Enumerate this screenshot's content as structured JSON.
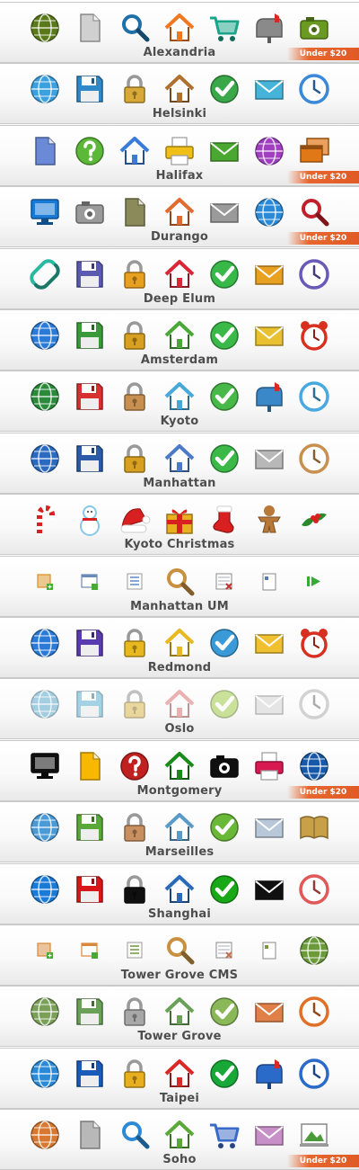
{
  "badge_text": "Under $20",
  "icon_sets": [
    {
      "name": "Alexandria",
      "badge": true,
      "style": "green-flat",
      "icons": [
        "globe-icon",
        "document-icon",
        "search-icon",
        "home-icon",
        "shopping-cart-icon",
        "mailbox-icon",
        "camera-icon"
      ],
      "colors": [
        "#5a7a1a",
        "#d0d0d0",
        "#1f6fa8",
        "#f07820",
        "#1aa58a",
        "#8a8a8a",
        "#6a9a22"
      ]
    },
    {
      "name": "Helsinki",
      "badge": false,
      "style": "outlined-blue",
      "icons": [
        "globe-icon",
        "floppy-disk-icon",
        "lock-icon",
        "home-icon",
        "checkmark-icon",
        "mail-icon",
        "clock-icon"
      ],
      "colors": [
        "#3aa0e0",
        "#2f88c8",
        "#d8a838",
        "#b07030",
        "#3aa848",
        "#45b4d8",
        "#3a88d8"
      ]
    },
    {
      "name": "Halifax",
      "badge": true,
      "style": "glossy",
      "icons": [
        "document-icon",
        "help-icon",
        "home-icon",
        "printer-icon",
        "mail-icon",
        "globe-icon",
        "windows-icon"
      ],
      "colors": [
        "#6a8ad8",
        "#5cb838",
        "#3a7ad8",
        "#f0c018",
        "#4aa830",
        "#a040c0",
        "#e07818"
      ]
    },
    {
      "name": "Durango",
      "badge": true,
      "style": "round",
      "icons": [
        "monitor-icon",
        "camera-icon",
        "document-icon",
        "home-icon",
        "mail-icon",
        "globe-icon",
        "search-icon"
      ],
      "colors": [
        "#1a7ad8",
        "#9a9a9a",
        "#8a8a5a",
        "#e06a30",
        "#9a9a9a",
        "#2a8ad8",
        "#c0202a"
      ]
    },
    {
      "name": "Deep Elum",
      "badge": false,
      "style": "line",
      "icons": [
        "link-icon",
        "floppy-disk-icon",
        "lock-icon",
        "home-icon",
        "checkmark-icon",
        "mail-icon",
        "clock-icon"
      ],
      "colors": [
        "#2ab8a0",
        "#5a5ab0",
        "#e8a020",
        "#d82838",
        "#38b848",
        "#e8a020",
        "#6a5ab8"
      ]
    },
    {
      "name": "Amsterdam",
      "badge": false,
      "style": "glossy",
      "icons": [
        "globe-icon",
        "floppy-disk-icon",
        "lock-icon",
        "home-icon",
        "checkmark-icon",
        "mail-icon",
        "alarm-clock-icon"
      ],
      "colors": [
        "#2a7ad8",
        "#3a9a3a",
        "#d8a020",
        "#4aa838",
        "#3ab848",
        "#e8c030",
        "#d83020"
      ]
    },
    {
      "name": "Kyoto",
      "badge": false,
      "style": "isometric",
      "icons": [
        "globe-icon",
        "floppy-disk-icon",
        "lock-icon",
        "home-icon",
        "checkmark-icon",
        "mailbox-icon",
        "clock-icon"
      ],
      "colors": [
        "#2a8a3a",
        "#d83030",
        "#c89050",
        "#48a8d8",
        "#48b848",
        "#3a88c8",
        "#48a8e0"
      ]
    },
    {
      "name": "Manhattan",
      "badge": false,
      "style": "classic",
      "icons": [
        "globe-icon",
        "floppy-disk-icon",
        "lock-icon",
        "home-icon",
        "checkmark-icon",
        "mail-icon",
        "clock-icon"
      ],
      "colors": [
        "#2a6ac0",
        "#2a5aa8",
        "#d8a020",
        "#4a7ac8",
        "#3ab848",
        "#b8b8b8",
        "#c89050"
      ]
    },
    {
      "name": "Kyoto Christmas",
      "badge": false,
      "style": "christmas",
      "icons": [
        "candy-cane-icon",
        "snowman-icon",
        "santa-hat-icon",
        "gift-icon",
        "stocking-icon",
        "gingerbread-icon",
        "holly-icon"
      ],
      "colors": [
        "#d82020",
        "#88c8e8",
        "#d82020",
        "#e8b020",
        "#d82020",
        "#b87838",
        "#2a8a2a"
      ]
    },
    {
      "name": "Manhattan UM",
      "badge": false,
      "style": "small",
      "icons": [
        "add-icon",
        "window-add-icon",
        "list-icon",
        "search-icon",
        "calendar-delete-icon",
        "page-icon",
        "arrow-right-icon"
      ],
      "colors": [
        "#d89020",
        "#6a8ab8",
        "#5a8ac8",
        "#c89040",
        "#c03030",
        "#5a7ab8",
        "#3aa838"
      ]
    },
    {
      "name": "Redmond",
      "badge": false,
      "style": "glossy",
      "icons": [
        "globe-icon",
        "floppy-disk-icon",
        "lock-icon",
        "home-icon",
        "checkmark-icon",
        "mail-icon",
        "alarm-clock-icon"
      ],
      "colors": [
        "#2a7ad8",
        "#5a3ab0",
        "#e8b820",
        "#e8b820",
        "#3a9ad8",
        "#f0c030",
        "#d83020"
      ]
    },
    {
      "name": "Oslo",
      "badge": false,
      "style": "pale",
      "icons": [
        "globe-icon",
        "floppy-disk-icon",
        "lock-icon",
        "home-icon",
        "checkmark-icon",
        "mail-icon",
        "clock-icon"
      ],
      "colors": [
        "#6ab0d0",
        "#6ab8d8",
        "#e0c060",
        "#e08080",
        "#a8d058",
        "#d8d8d8",
        "#b8b8b8"
      ]
    },
    {
      "name": "Montgomery",
      "badge": true,
      "style": "pixel",
      "icons": [
        "monitor-icon",
        "document-icon",
        "help-icon",
        "home-icon",
        "camera-icon",
        "printer-icon",
        "globe-icon"
      ],
      "colors": [
        "#101010",
        "#f8b800",
        "#c02020",
        "#1a8a1a",
        "#101010",
        "#d81850",
        "#1858a8"
      ]
    },
    {
      "name": "Marseilles",
      "badge": false,
      "style": "soft",
      "icons": [
        "globe-icon",
        "floppy-disk-icon",
        "lock-icon",
        "home-icon",
        "checkmark-icon",
        "mail-icon",
        "book-icon"
      ],
      "colors": [
        "#4a9ad8",
        "#5aa838",
        "#c89060",
        "#5a9ac8",
        "#6ab838",
        "#b8c8d8",
        "#c8a048"
      ]
    },
    {
      "name": "Shanghai",
      "badge": false,
      "style": "bold",
      "icons": [
        "globe-icon",
        "floppy-disk-icon",
        "lock-icon",
        "home-icon",
        "checkmark-icon",
        "mail-icon",
        "clock-icon"
      ],
      "colors": [
        "#1a7ad8",
        "#d81818",
        "#101010",
        "#2a6ab8",
        "#18a818",
        "#101010",
        "#e05858"
      ]
    },
    {
      "name": "Tower Grove CMS",
      "badge": false,
      "style": "small",
      "icons": [
        "add-icon",
        "window-add-icon",
        "list-icon",
        "search-icon",
        "calendar-delete-icon",
        "page-icon",
        "globe-icon"
      ],
      "colors": [
        "#d88838",
        "#d88838",
        "#6a9a3a",
        "#c89040",
        "#c07050",
        "#7a9a3a",
        "#6a9a3a"
      ]
    },
    {
      "name": "Tower Grove",
      "badge": false,
      "style": "soft",
      "icons": [
        "globe-icon",
        "floppy-disk-icon",
        "lock-icon",
        "home-icon",
        "checkmark-icon",
        "mail-icon",
        "clock-icon"
      ],
      "colors": [
        "#7aa058",
        "#6aa058",
        "#a8a8a8",
        "#6aa058",
        "#8ab858",
        "#e08048",
        "#e07028"
      ]
    },
    {
      "name": "Taipei",
      "badge": false,
      "style": "glossy",
      "icons": [
        "globe-icon",
        "floppy-disk-icon",
        "lock-icon",
        "home-icon",
        "checkmark-icon",
        "mailbox-icon",
        "clock-icon"
      ],
      "colors": [
        "#2a8ad8",
        "#1a5ab8",
        "#e8b020",
        "#d82828",
        "#18a838",
        "#2a6ac8",
        "#2a6ac8"
      ]
    },
    {
      "name": "Soho",
      "badge": true,
      "style": "glossy",
      "icons": [
        "globe-icon",
        "document-icon",
        "search-icon",
        "home-icon",
        "shopping-cart-icon",
        "mail-icon",
        "picture-icon"
      ],
      "colors": [
        "#d87830",
        "#b8b8b8",
        "#2a8ad8",
        "#5aa838",
        "#3a6ac8",
        "#c890c8",
        "#4a9a3a"
      ]
    }
  ]
}
